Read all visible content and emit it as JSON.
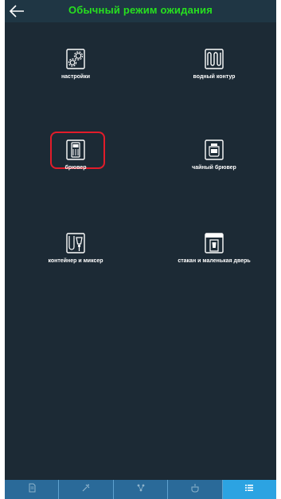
{
  "header": {
    "title": "Обычный режим ожидания"
  },
  "tiles": [
    {
      "label": "настройки",
      "icon": "gears-icon"
    },
    {
      "label": "водный контур",
      "icon": "water-circuit-icon"
    },
    {
      "label": "брювер",
      "icon": "brewer-icon",
      "selected": true
    },
    {
      "label": "чайный брювер",
      "icon": "tea-brewer-icon"
    },
    {
      "label": "контейнер и миксер",
      "icon": "container-mixer-icon"
    },
    {
      "label": "стакан и маленькая дверь",
      "icon": "cup-small-door-icon"
    }
  ],
  "bottom_nav": [
    {
      "icon": "document-icon",
      "active": false
    },
    {
      "icon": "mixer-tools-icon",
      "active": false
    },
    {
      "icon": "network-icon",
      "active": false
    },
    {
      "icon": "cup-icon",
      "active": false
    },
    {
      "icon": "list-icon",
      "active": true
    }
  ],
  "colors": {
    "background": "#1c2a35",
    "title": "#27e01f",
    "highlight": "#e21c2a",
    "nav_active": "#2ca3e2"
  }
}
